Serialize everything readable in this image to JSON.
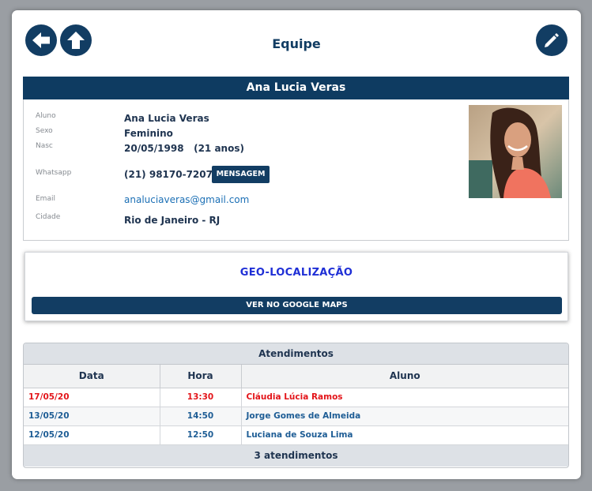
{
  "header": {
    "title": "Equipe",
    "back_icon": "arrow-left-icon",
    "up_icon": "arrow-up-icon",
    "edit_icon": "pencil-icon"
  },
  "profile": {
    "name": "Ana Lucia Veras",
    "fields": {
      "aluno_label": "Aluno",
      "aluno_value": "Ana Lucia Veras",
      "sexo_label": "Sexo",
      "sexo_value": "Feminino",
      "nasc_label": "Nasc",
      "nasc_value": "20/05/1998   (21 anos)",
      "whatsapp_label": "Whatsapp",
      "whatsapp_value": "(21) 98170-7207",
      "email_label": "Email",
      "email_value": "analuciaveras@gmail.com",
      "cidade_label": "Cidade",
      "cidade_value": "Rio de Janeiro - RJ"
    },
    "message_button": "MENSAGEM"
  },
  "geo": {
    "title": "GEO-LOCALIZAÇÃO",
    "maps_button": "VER NO GOOGLE MAPS"
  },
  "appointments": {
    "title": "Atendimentos",
    "columns": [
      "Data",
      "Hora",
      "Aluno"
    ],
    "rows": [
      {
        "data": "17/05/20",
        "hora": "13:30",
        "aluno": "Cláudia Lúcia Ramos"
      },
      {
        "data": "13/05/20",
        "hora": "14:50",
        "aluno": "Jorge Gomes de Almeida"
      },
      {
        "data": "12/05/20",
        "hora": "12:50",
        "aluno": "Luciana de Souza Lima"
      }
    ],
    "footer": "3 atendimentos"
  },
  "colors": {
    "primary": "#123d63",
    "highlight_row": "#e3151a",
    "geo_title": "#1f2fd6",
    "link": "#1b6fb5"
  }
}
